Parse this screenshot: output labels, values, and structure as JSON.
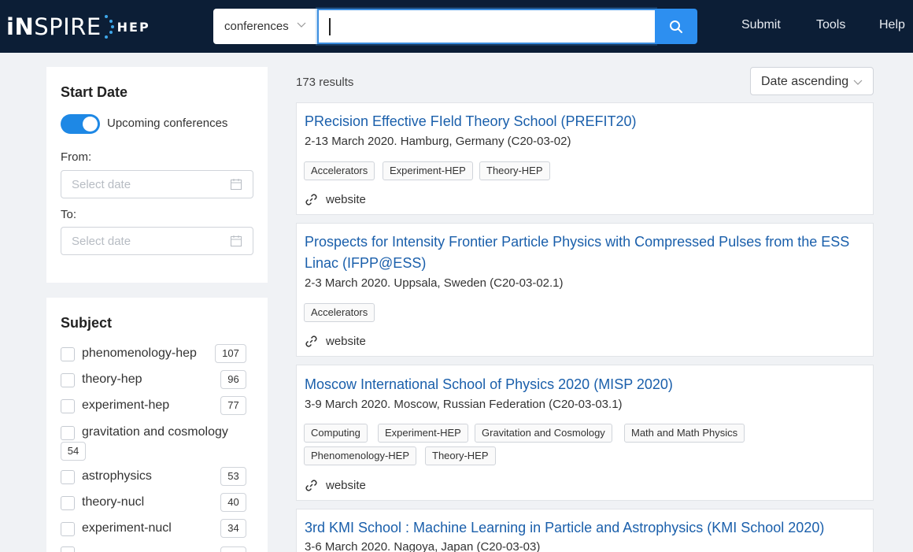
{
  "header": {
    "logo_main_bold": "iN",
    "logo_main_rest": "SPIRE",
    "logo_sub": "HEP",
    "search_scope": "conferences",
    "search_value": "",
    "nav": [
      "Submit",
      "Tools",
      "Help"
    ]
  },
  "colors": {
    "header_bg": "#0c1e36",
    "accent": "#2d8ff0",
    "link": "#1a5fab"
  },
  "start_date": {
    "title": "Start Date",
    "toggle_label": "Upcoming conferences",
    "toggle_on": true,
    "from_label": "From:",
    "from_placeholder": "Select date",
    "to_label": "To:",
    "to_placeholder": "Select date"
  },
  "subject": {
    "title": "Subject",
    "items": [
      {
        "label": "phenomenology-hep",
        "count": "107"
      },
      {
        "label": "theory-hep",
        "count": "96"
      },
      {
        "label": "experiment-hep",
        "count": "77"
      },
      {
        "label": "gravitation and cosmology",
        "count": "54"
      },
      {
        "label": "astrophysics",
        "count": "53"
      },
      {
        "label": "theory-nucl",
        "count": "40"
      },
      {
        "label": "experiment-nucl",
        "count": "34"
      }
    ]
  },
  "results": {
    "count_text": "173 results",
    "sort_value": "Date ascending",
    "cards": [
      {
        "title": "PRecision Effective FIeld Theory School (PREFIT20)",
        "meta": "2-13 March 2020. Hamburg, Germany (C20-03-02)",
        "tags": [
          "Accelerators",
          "Experiment-HEP",
          "Theory-HEP"
        ],
        "link": "website"
      },
      {
        "title": "Prospects for Intensity Frontier Particle Physics with Compressed Pulses from the ESS Linac (IFPP@ESS)",
        "meta": "2-3 March 2020. Uppsala, Sweden (C20-03-02.1)",
        "tags": [
          "Accelerators"
        ],
        "link": "website"
      },
      {
        "title": "Moscow International School of Physics 2020 (MISP 2020)",
        "meta": "3-9 March 2020. Moscow, Russian Federation (C20-03-03.1)",
        "tags": [
          "Computing",
          "Experiment-HEP",
          "Gravitation and Cosmology",
          "Math and Math Physics",
          "Phenomenology-HEP",
          "Theory-HEP"
        ],
        "link": "website"
      },
      {
        "title": "3rd KMI School : Machine Learning in Particle and Astrophysics (KMI School 2020)",
        "meta": "3-6 March 2020. Nagoya, Japan (C20-03-03)",
        "tags": [],
        "link": ""
      }
    ]
  }
}
